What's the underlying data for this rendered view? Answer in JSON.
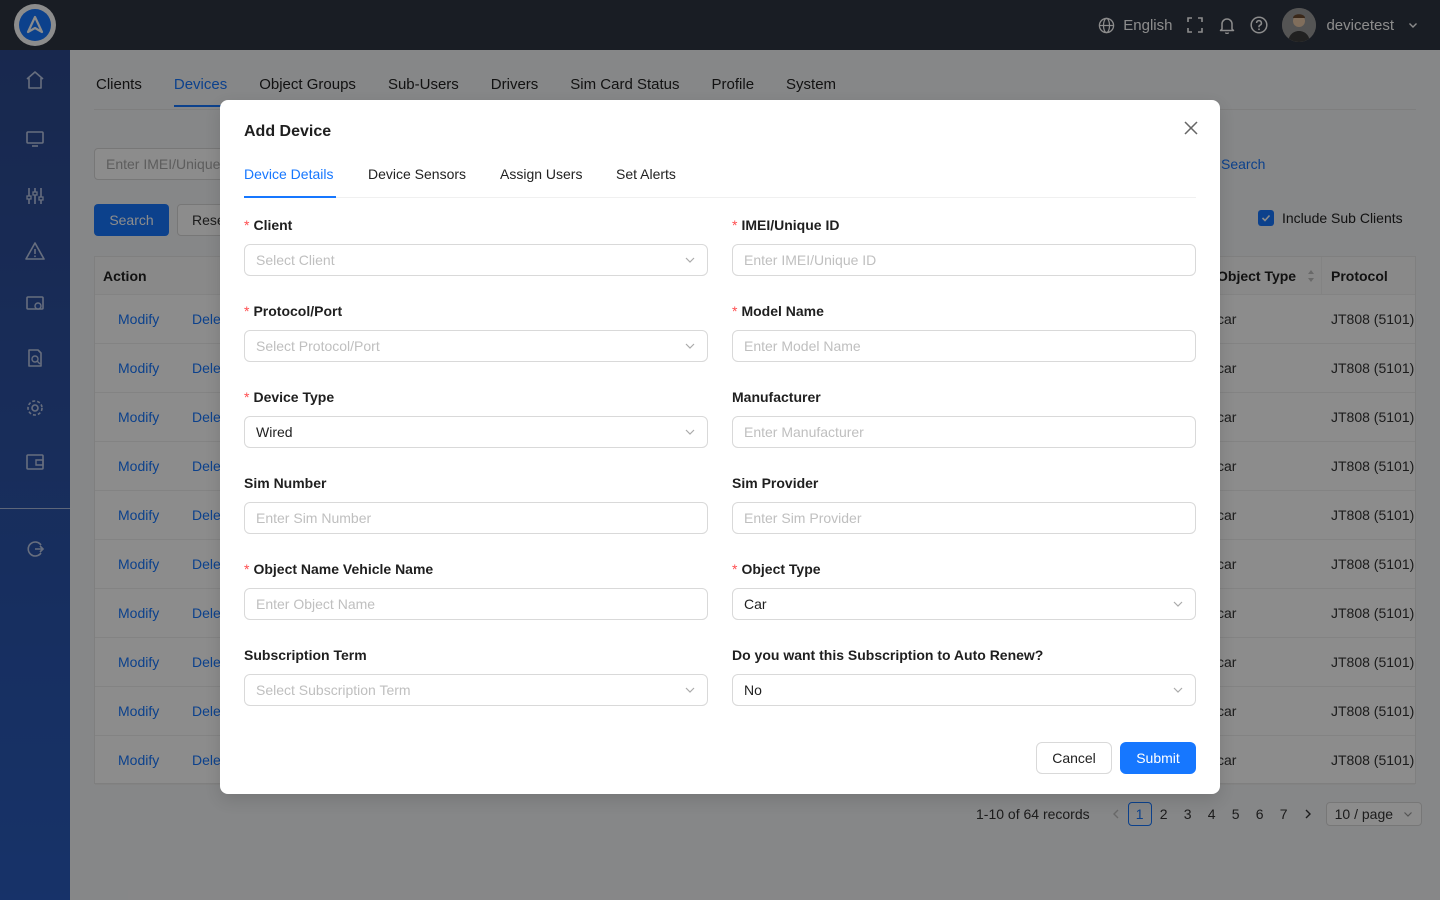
{
  "topbar": {
    "language": "English",
    "username": "devicetest"
  },
  "background": {
    "nav_tabs": [
      "Clients",
      "Devices",
      "Object Groups",
      "Sub-Users",
      "Drivers",
      "Sim Card Status",
      "Profile",
      "System"
    ],
    "search_placeholder": "Enter IMEI/Unique",
    "search_link": "Search",
    "search_button": "Search",
    "reset_button": "Rese",
    "include_sub_clients": "Include Sub Clients",
    "table": {
      "headers": {
        "action": "Action",
        "object_type": "Object Type",
        "protocol": "Protocol"
      },
      "modify_label": "Modify",
      "delete_label": "Dele",
      "rows": [
        {
          "object_type": "car",
          "protocol": "JT808 (5101)"
        },
        {
          "object_type": "car",
          "protocol": "JT808 (5101)"
        },
        {
          "object_type": "car",
          "protocol": "JT808 (5101)"
        },
        {
          "object_type": "car",
          "protocol": "JT808 (5101)"
        },
        {
          "object_type": "car",
          "protocol": "JT808 (5101)"
        },
        {
          "object_type": "car",
          "protocol": "JT808 (5101)"
        },
        {
          "object_type": "car",
          "protocol": "JT808 (5101)"
        },
        {
          "object_type": "car",
          "protocol": "JT808 (5101)"
        },
        {
          "object_type": "car",
          "protocol": "JT808 (5101)"
        },
        {
          "object_type": "car",
          "protocol": "JT808 (5101)"
        }
      ]
    },
    "pagination": {
      "total": "1-10 of 64 records",
      "pages": [
        "1",
        "2",
        "3",
        "4",
        "5",
        "6",
        "7"
      ],
      "current": "1",
      "page_size": "10 / page"
    }
  },
  "modal": {
    "title": "Add Device",
    "tabs": [
      "Device Details",
      "Device Sensors",
      "Assign Users",
      "Set Alerts"
    ],
    "fields": {
      "client": {
        "label": "Client",
        "placeholder": "Select Client"
      },
      "imei": {
        "label": "IMEI/Unique ID",
        "placeholder": "Enter IMEI/Unique ID"
      },
      "protocol": {
        "label": "Protocol/Port",
        "placeholder": "Select Protocol/Port"
      },
      "model": {
        "label": "Model Name",
        "placeholder": "Enter Model Name"
      },
      "device_type": {
        "label": "Device Type",
        "value": "Wired"
      },
      "manufacturer": {
        "label": "Manufacturer",
        "placeholder": "Enter Manufacturer"
      },
      "sim_number": {
        "label": "Sim Number",
        "placeholder": "Enter Sim Number"
      },
      "sim_provider": {
        "label": "Sim Provider",
        "placeholder": "Enter Sim Provider"
      },
      "object_name": {
        "label": "Object Name Vehicle Name",
        "placeholder": "Enter Object Name"
      },
      "object_type": {
        "label": "Object Type",
        "value": "Car"
      },
      "subscription_term": {
        "label": "Subscription Term",
        "placeholder": "Select Subscription Term"
      },
      "auto_renew": {
        "label": "Do you want this Subscription to Auto Renew?",
        "value": "No"
      }
    },
    "required_mark": "*",
    "cancel_label": "Cancel",
    "submit_label": "Submit"
  },
  "colors": {
    "accent": "#1677ff",
    "topbar": "#2f3542",
    "required": "#ff4d4f"
  }
}
